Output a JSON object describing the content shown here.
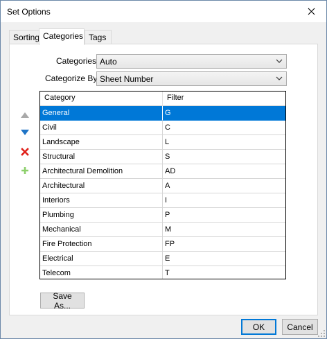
{
  "window": {
    "title": "Set Options"
  },
  "tabs": [
    {
      "label": "Sorting"
    },
    {
      "label": "Categories"
    },
    {
      "label": "Tags"
    }
  ],
  "form": {
    "categories_label": "Categories:",
    "categories_value": "Auto",
    "categorize_by_label": "Categorize By:",
    "categorize_by_value": "Sheet Number"
  },
  "table": {
    "columns": [
      "Category",
      "Filter"
    ],
    "selected_index": 0,
    "rows": [
      {
        "category": "General",
        "filter": "G"
      },
      {
        "category": "Civil",
        "filter": "C"
      },
      {
        "category": "Landscape",
        "filter": "L"
      },
      {
        "category": "Structural",
        "filter": "S"
      },
      {
        "category": "Architectural Demolition",
        "filter": "AD"
      },
      {
        "category": "Architectural",
        "filter": "A"
      },
      {
        "category": "Interiors",
        "filter": "I"
      },
      {
        "category": "Plumbing",
        "filter": "P"
      },
      {
        "category": "Mechanical",
        "filter": "M"
      },
      {
        "category": "Fire Protection",
        "filter": "FP"
      },
      {
        "category": "Electrical",
        "filter": "E"
      },
      {
        "category": "Telecom",
        "filter": "T"
      }
    ]
  },
  "side_buttons": [
    {
      "icon": "move-up-icon",
      "color": "#a9a9a9"
    },
    {
      "icon": "move-down-icon",
      "color": "#1f74c6"
    },
    {
      "icon": "delete-icon",
      "color": "#e0201a"
    },
    {
      "icon": "add-icon",
      "color": "#8ccf6a"
    }
  ],
  "buttons": {
    "save_as": "Save As...",
    "ok": "OK",
    "cancel": "Cancel"
  },
  "colors": {
    "selection": "#0078d7",
    "default_button_border": "#0078d7"
  }
}
